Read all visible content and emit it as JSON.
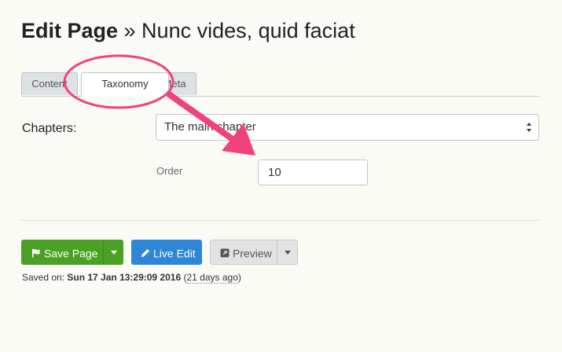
{
  "page": {
    "title_bold": "Edit Page",
    "title_rest": " » Nunc vides, quid faciat"
  },
  "tabs": [
    {
      "label": "Content"
    },
    {
      "label": "Taxonomy",
      "active": true
    },
    {
      "label": "Meta"
    }
  ],
  "form": {
    "chapters_label": "Chapters:",
    "chapters_value": "The main chapter",
    "order_label": "Order",
    "order_value": "10"
  },
  "buttons": {
    "save": "Save Page",
    "live_edit": "Live Edit",
    "preview": "Preview"
  },
  "status": {
    "saved_prefix": "Saved on: ",
    "saved_date": "Sun 17 Jan 13:29:09 2016",
    "open_paren": " (",
    "saved_ago": "21 days ago",
    "close_paren": ")"
  },
  "colors": {
    "annotation": "#f0427d",
    "save": "#4aa123",
    "live": "#2e86d6"
  },
  "icons": {
    "save": "flag-icon",
    "live_edit": "pencil-icon",
    "preview": "external-link-icon"
  }
}
